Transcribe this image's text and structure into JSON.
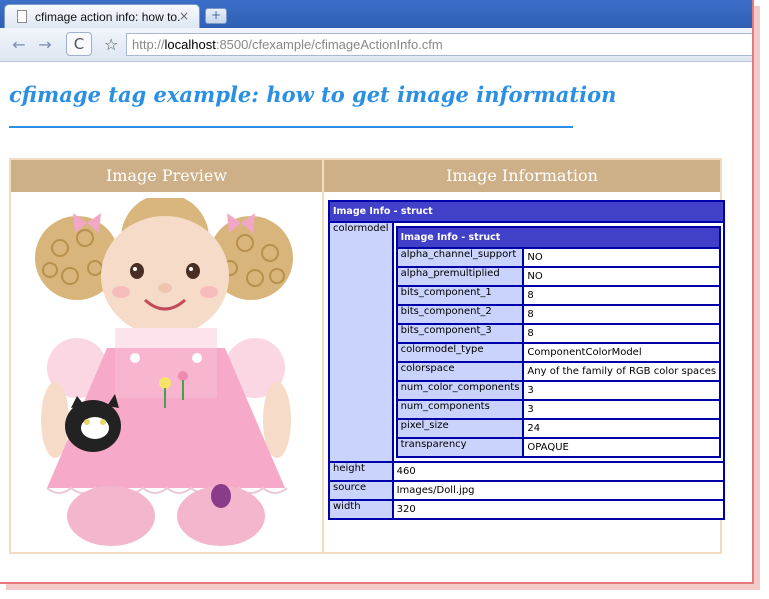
{
  "browser": {
    "tab_title": "cfimage action info: how to...",
    "tab_close": "×",
    "new_tab": "+",
    "back": "←",
    "forward": "→",
    "reload": "C",
    "star": "☆",
    "url_scheme": "http://",
    "url_host": "localhost",
    "url_rest": ":8500/cfexample/cfimageActionInfo.cfm"
  },
  "page": {
    "title": "cfimage tag example: how to get image information",
    "col_preview": "Image Preview",
    "col_info": "Image Information"
  },
  "dump": {
    "header": "Image Info - struct",
    "colormodel_key": "colormodel",
    "inner_header": "Image Info - struct",
    "colormodel": [
      {
        "key": "alpha_channel_support",
        "value": "NO"
      },
      {
        "key": "alpha_premultiplied",
        "value": "NO"
      },
      {
        "key": "bits_component_1",
        "value": "8"
      },
      {
        "key": "bits_component_2",
        "value": "8"
      },
      {
        "key": "bits_component_3",
        "value": "8"
      },
      {
        "key": "colormodel_type",
        "value": "ComponentColorModel"
      },
      {
        "key": "colorspace",
        "value": "Any of the family of RGB color spaces"
      },
      {
        "key": "num_color_components",
        "value": "3"
      },
      {
        "key": "num_components",
        "value": "3"
      },
      {
        "key": "pixel_size",
        "value": "24"
      },
      {
        "key": "transparency",
        "value": "OPAQUE"
      }
    ],
    "rows": [
      {
        "key": "height",
        "value": "460"
      },
      {
        "key": "source",
        "value": "Images/Doll.jpg"
      },
      {
        "key": "width",
        "value": "320"
      }
    ]
  },
  "colors": {
    "title": "#2b8fe6",
    "header_bg": "#ceb088",
    "dump_border": "#0000aa",
    "dump_header": "#4040c8",
    "dump_key_bg": "#c9d3fb"
  }
}
